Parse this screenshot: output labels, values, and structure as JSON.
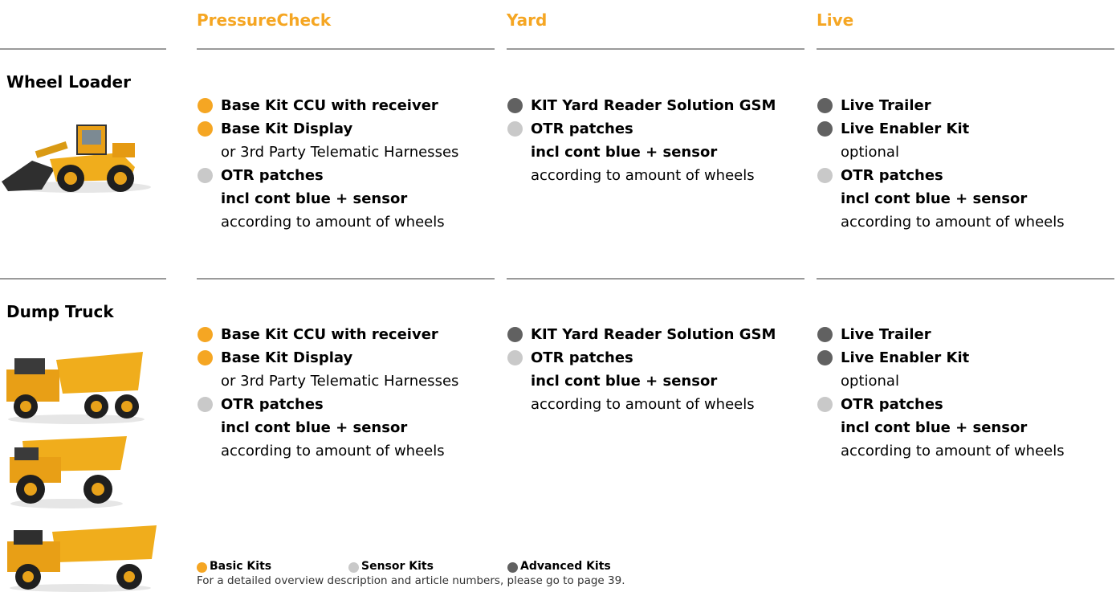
{
  "columns": {
    "pressurecheck": "PressureCheck",
    "yard": "Yard",
    "live": "Live"
  },
  "colors": {
    "accent": "#f5a623",
    "basic_dot": "#f5a623",
    "sensor_dot": "#c9c9c9",
    "advanced_dot": "#616161",
    "rule": "#9a9a9a"
  },
  "sections": [
    {
      "vehicle": "Wheel Loader",
      "image": "wheel-loader-image",
      "pressurecheck": [
        {
          "text": "Base Kit CCU with receiver",
          "dot": "orange",
          "bold": true
        },
        {
          "text": "Base Kit Display",
          "dot": "orange",
          "bold": true
        },
        {
          "text": "or 3rd Party Telematic Harnesses",
          "dot": "",
          "bold": false
        },
        {
          "text": "OTR patches",
          "dot": "light",
          "bold": true
        },
        {
          "text": "incl cont blue + sensor",
          "dot": "",
          "bold": true
        },
        {
          "text": "according to amount of wheels",
          "dot": "",
          "bold": false
        }
      ],
      "yard": [
        {
          "text": "KIT Yard Reader Solution GSM",
          "dot": "dark",
          "bold": true
        },
        {
          "text": "OTR patches",
          "dot": "light",
          "bold": true
        },
        {
          "text": "incl cont blue + sensor",
          "dot": "",
          "bold": true
        },
        {
          "text": "according to amount of wheels",
          "dot": "",
          "bold": false
        }
      ],
      "live": [
        {
          "text": "Live Trailer",
          "dot": "dark",
          "bold": true
        },
        {
          "text": "Live Enabler Kit",
          "dot": "dark",
          "bold": true
        },
        {
          "text": "optional",
          "dot": "",
          "bold": false
        },
        {
          "text": "OTR patches",
          "dot": "light",
          "bold": true
        },
        {
          "text": "incl cont blue + sensor",
          "dot": "",
          "bold": true
        },
        {
          "text": "according to amount of wheels",
          "dot": "",
          "bold": false
        }
      ]
    },
    {
      "vehicle": "Dump Truck",
      "image": "dump-truck-images",
      "pressurecheck": [
        {
          "text": "Base Kit CCU with receiver",
          "dot": "orange",
          "bold": true
        },
        {
          "text": "Base Kit Display",
          "dot": "orange",
          "bold": true
        },
        {
          "text": "or 3rd Party Telematic Harnesses",
          "dot": "",
          "bold": false
        },
        {
          "text": "OTR patches",
          "dot": "light",
          "bold": true
        },
        {
          "text": "incl cont blue + sensor",
          "dot": "",
          "bold": true
        },
        {
          "text": "according to amount of wheels",
          "dot": "",
          "bold": false
        }
      ],
      "yard": [
        {
          "text": "KIT Yard Reader Solution GSM",
          "dot": "dark",
          "bold": true
        },
        {
          "text": "OTR patches",
          "dot": "light",
          "bold": true
        },
        {
          "text": "incl cont blue + sensor",
          "dot": "",
          "bold": true
        },
        {
          "text": "according to amount of wheels",
          "dot": "",
          "bold": false
        }
      ],
      "live": [
        {
          "text": "Live Trailer",
          "dot": "dark",
          "bold": true
        },
        {
          "text": "Live Enabler Kit",
          "dot": "dark",
          "bold": true
        },
        {
          "text": "optional",
          "dot": "",
          "bold": false
        },
        {
          "text": "OTR patches",
          "dot": "light",
          "bold": true
        },
        {
          "text": "incl cont blue + sensor",
          "dot": "",
          "bold": true
        },
        {
          "text": "according to amount of wheels",
          "dot": "",
          "bold": false
        }
      ]
    }
  ],
  "legend": {
    "basic": "Basic Kits",
    "sensor": "Sensor Kits",
    "advanced": "Advanced Kits"
  },
  "footnote": "For a detailed overview description and article numbers, please go to page 39."
}
